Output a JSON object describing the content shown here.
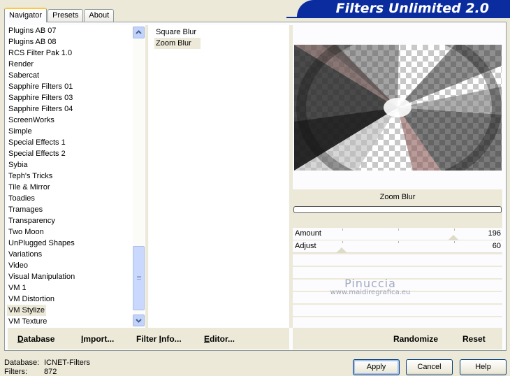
{
  "title": "Filters Unlimited 2.0",
  "tabs": [
    {
      "label": "Navigator"
    },
    {
      "label": "Presets"
    },
    {
      "label": "About"
    }
  ],
  "categories": [
    "Plugins AB 07",
    "Plugins AB 08",
    "RCS Filter Pak 1.0",
    "Render",
    "Sabercat",
    "Sapphire Filters 01",
    "Sapphire Filters 03",
    "Sapphire Filters 04",
    "ScreenWorks",
    "Simple",
    "Special Effects 1",
    "Special Effects 2",
    "Sybia",
    "Teph's Tricks",
    "Tile & Mirror",
    "Toadies",
    "Tramages",
    "Transparency",
    "Two Moon",
    "UnPlugged Shapes",
    "Variations",
    "Video",
    "Visual Manipulation",
    "VM 1",
    "VM Distortion",
    "VM Stylize",
    "VM Texture"
  ],
  "selected_category": "VM Stylize",
  "filters": [
    "Square Blur",
    "Zoom Blur"
  ],
  "selected_filter": "Zoom Blur",
  "filter_name": "Zoom Blur",
  "params": [
    {
      "label": "Amount",
      "value": "196",
      "level": 0.77
    },
    {
      "label": "Adjust",
      "value": "60",
      "level": 0.24
    }
  ],
  "watermark": {
    "name": "Pinuccia",
    "url": "www.maidiregrafica.eu"
  },
  "left_buttons": {
    "database": "Database",
    "import": "Import...",
    "filter_info": "Filter Info...",
    "editor": "Editor..."
  },
  "right_buttons": {
    "randomize": "Randomize",
    "reset": "Reset"
  },
  "status": {
    "database_label": "Database:",
    "database_value": "ICNET-Filters",
    "filters_label": "Filters:",
    "filters_value": "872"
  },
  "dialog_buttons": {
    "apply": "Apply",
    "cancel": "Cancel",
    "help": "Help"
  },
  "icons": {
    "scroll_up": "chevron-up-icon",
    "scroll_down": "chevron-down-icon"
  },
  "colors": {
    "banner": "#0a2c9e",
    "face": "#ece9d8"
  }
}
